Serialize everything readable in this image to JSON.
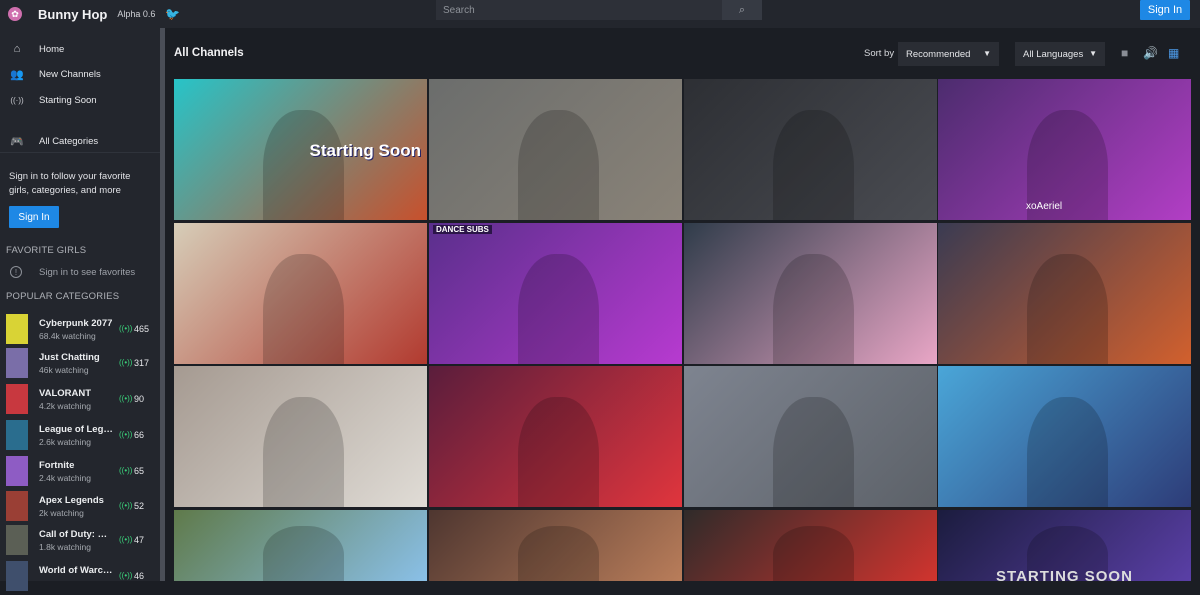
{
  "app": {
    "title": "Bunny Hop",
    "version": "Alpha 0.6",
    "logo_icon": "bunny-logo-icon",
    "twitter_icon": "twitter-icon"
  },
  "search": {
    "placeholder": "Search",
    "value": "",
    "button_icon": "search-icon"
  },
  "top_signin_label": "Sign In",
  "sidebar": {
    "nav": [
      {
        "label": "Home",
        "icon": "home-icon",
        "glyph": "⌂"
      },
      {
        "label": "New Channels",
        "icon": "people-icon",
        "glyph": "👥"
      },
      {
        "label": "Starting Soon",
        "icon": "broadcast-icon",
        "glyph": "((·))"
      }
    ],
    "all_categories": {
      "label": "All Categories",
      "icon": "gamepad-icon",
      "glyph": "🎮"
    },
    "prompt": "Sign in to follow your favorite girls, categories, and more",
    "signin_label": "Sign In",
    "favorite_heading": "FAVORITE GIRLS",
    "favorite_empty": "Sign in to see favorites",
    "popular_heading": "POPULAR CATEGORIES",
    "categories": [
      {
        "name": "Cyberpunk 2077",
        "watching": "68.4k watching",
        "count": "465",
        "color": "#d9d335"
      },
      {
        "name": "Just Chatting",
        "watching": "46k watching",
        "count": "317",
        "color": "#7a6ea8"
      },
      {
        "name": "VALORANT",
        "watching": "4.2k watching",
        "count": "90",
        "color": "#c8383f"
      },
      {
        "name": "League of Legends",
        "watching": "2.6k watching",
        "count": "66",
        "color": "#2a6d8e"
      },
      {
        "name": "Fortnite",
        "watching": "2.4k watching",
        "count": "65",
        "color": "#8e5cc4"
      },
      {
        "name": "Apex Legends",
        "watching": "2k watching",
        "count": "52",
        "color": "#9a3f35"
      },
      {
        "name": "Call of Duty: Warzone",
        "watching": "1.8k watching",
        "count": "47",
        "color": "#5b5f55"
      },
      {
        "name": "World of Warcraft",
        "watching": "",
        "count": "46",
        "color": "#3f4f6c"
      }
    ]
  },
  "main": {
    "title": "All Channels",
    "sort_label": "Sort by",
    "sort_value": "Recommended",
    "language_value": "All Languages",
    "view_icons": [
      "video-icon",
      "volume-icon",
      "grid-icon"
    ]
  },
  "tiles": [
    {
      "color": "#27c4c8",
      "accent": "#c8502c",
      "overlay": "Starting Soon"
    },
    {
      "color": "#6b6d6c",
      "accent": "#8a8378",
      "overlay": ""
    },
    {
      "color": "#2d2f34",
      "accent": "#4a4c52",
      "overlay": ""
    },
    {
      "color": "#4c2c6e",
      "accent": "#b23ec5",
      "overlay": "xoAeriel"
    },
    {
      "color": "#d6cdb8",
      "accent": "#b23a2f",
      "overlay": ""
    },
    {
      "color": "#5a2f8c",
      "accent": "#b73ad0",
      "overlay": "DANCE SUBS"
    },
    {
      "color": "#2f3c4a",
      "accent": "#e9a6c6",
      "overlay": ""
    },
    {
      "color": "#3a3b52",
      "accent": "#d2602d",
      "overlay": ""
    },
    {
      "color": "#a59a91",
      "accent": "#e0dcd6",
      "overlay": ""
    },
    {
      "color": "#5a1d3c",
      "accent": "#e0353d",
      "overlay": ""
    },
    {
      "color": "#7e8490",
      "accent": "#5c6168",
      "overlay": ""
    },
    {
      "color": "#4aa6d8",
      "accent": "#2d3c78",
      "overlay": ""
    },
    {
      "color": "#5f7a4a",
      "accent": "#8ac0e8",
      "overlay": ""
    },
    {
      "color": "#4e3630",
      "accent": "#b97d5a",
      "overlay": ""
    },
    {
      "color": "#2f2b2a",
      "accent": "#d1342e",
      "overlay": ""
    },
    {
      "color": "#1b1c3e",
      "accent": "#5a3fa6",
      "overlay": "STARTING SOON"
    }
  ]
}
